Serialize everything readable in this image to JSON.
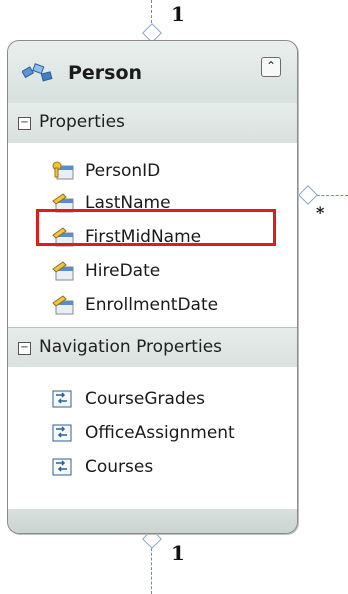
{
  "entity": {
    "name": "Person",
    "collapse_glyph": "⌃",
    "sections": [
      {
        "title": "Properties",
        "toggle": "−",
        "items": [
          {
            "label": "PersonID",
            "icon": "key-property-icon"
          },
          {
            "label": "LastName",
            "icon": "property-icon"
          },
          {
            "label": "FirstMidName",
            "icon": "property-icon",
            "highlighted": true
          },
          {
            "label": "HireDate",
            "icon": "property-icon"
          },
          {
            "label": "EnrollmentDate",
            "icon": "property-icon"
          }
        ]
      },
      {
        "title": "Navigation Properties",
        "toggle": "−",
        "items": [
          {
            "label": "CourseGrades",
            "icon": "navigation-property-icon"
          },
          {
            "label": "OfficeAssignment",
            "icon": "navigation-property-icon"
          },
          {
            "label": "Courses",
            "icon": "navigation-property-icon"
          }
        ]
      }
    ]
  },
  "connectors": {
    "top_multiplicity": "1",
    "right_multiplicity": "*",
    "bottom_multiplicity": "1"
  },
  "colors": {
    "highlight": "#e01b1b",
    "connector": "#6c8fb0"
  }
}
